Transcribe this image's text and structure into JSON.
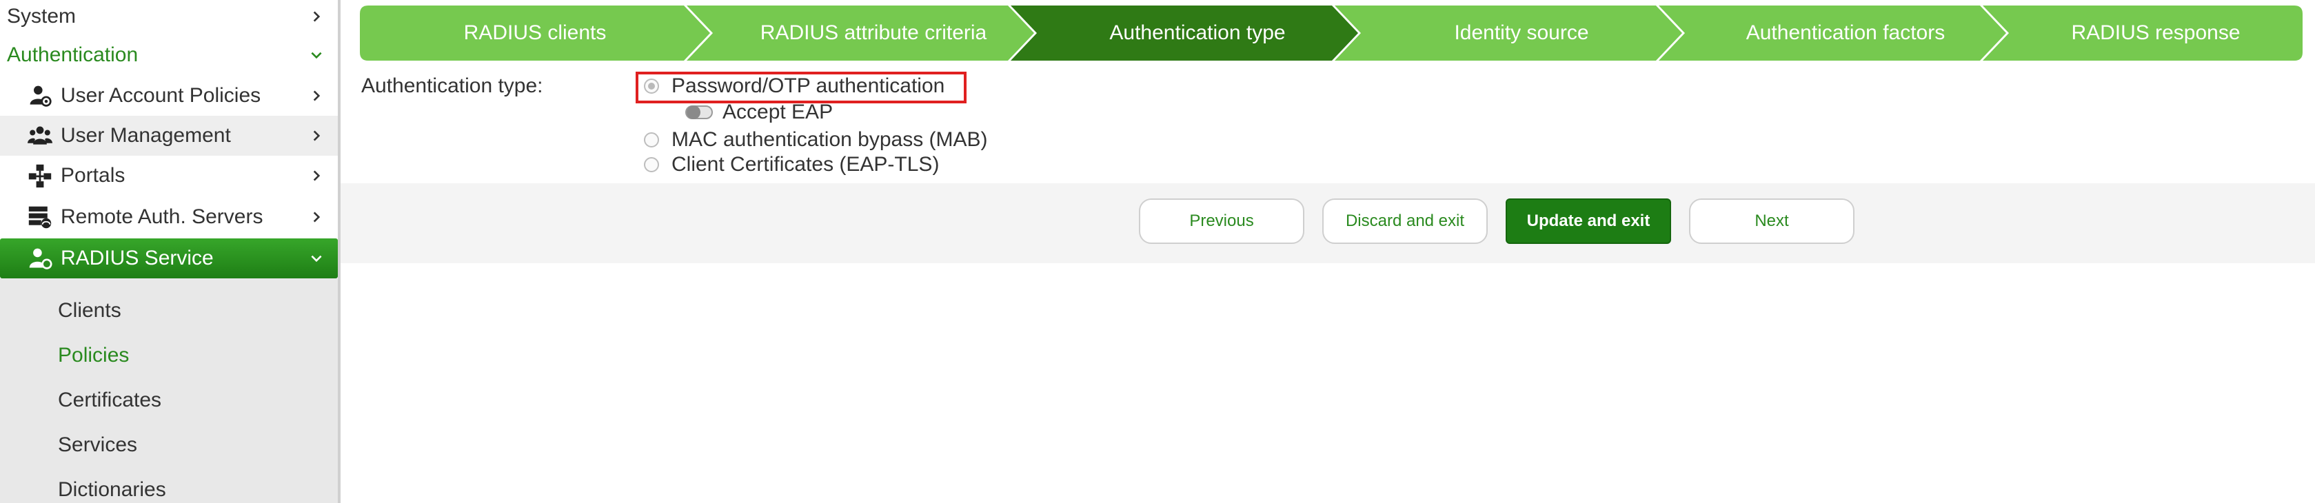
{
  "sidebar": {
    "system": "System",
    "authentication": "Authentication",
    "items": [
      {
        "label": "User Account Policies",
        "icon": "user-policy-icon"
      },
      {
        "label": "User Management",
        "icon": "users-icon"
      },
      {
        "label": "Portals",
        "icon": "portals-icon"
      },
      {
        "label": "Remote Auth. Servers",
        "icon": "remote-servers-icon"
      },
      {
        "label": "RADIUS Service",
        "icon": "radius-icon"
      }
    ],
    "radius_sub": [
      {
        "label": "Clients"
      },
      {
        "label": "Policies"
      },
      {
        "label": "Certificates"
      },
      {
        "label": "Services"
      },
      {
        "label": "Dictionaries"
      }
    ]
  },
  "wizard": {
    "steps": [
      "RADIUS clients",
      "RADIUS attribute criteria",
      "Authentication type",
      "Identity source",
      "Authentication factors",
      "RADIUS response"
    ],
    "active_step": 2,
    "colors": {
      "step": "#76c94f",
      "active": "#2f7a15"
    }
  },
  "form": {
    "label": "Authentication type:",
    "options": [
      "Password/OTP authentication",
      "MAC authentication bypass (MAB)",
      "Client Certificates (EAP-TLS)"
    ],
    "selected": "Password/OTP authentication",
    "accept_eap": "Accept EAP"
  },
  "buttons": {
    "previous": "Previous",
    "discard": "Discard and exit",
    "update": "Update and exit",
    "next": "Next"
  }
}
